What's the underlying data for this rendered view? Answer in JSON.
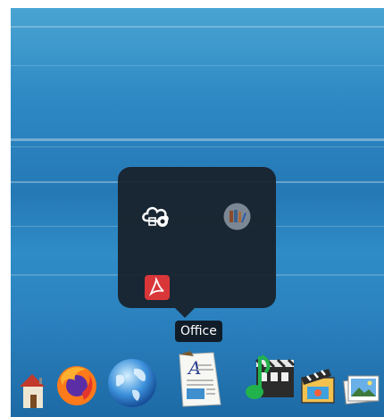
{
  "folder": {
    "name": "Office",
    "apps": [
      {
        "icon": "cloud-settings-icon"
      },
      {
        "icon": "library-icon"
      },
      {
        "icon": "pdf-reader-icon"
      }
    ]
  },
  "dock": {
    "items": [
      {
        "icon": "home-folder-icon"
      },
      {
        "icon": "firefox-icon"
      },
      {
        "icon": "globe-browser-icon"
      },
      {
        "icon": "office-folder-icon"
      },
      {
        "icon": "music-player-icon"
      },
      {
        "icon": "video-clapper-icon"
      },
      {
        "icon": "photos-icon"
      }
    ]
  },
  "colors": {
    "accent_pdf": "#d9363a",
    "popup_bg": "#18212a"
  }
}
